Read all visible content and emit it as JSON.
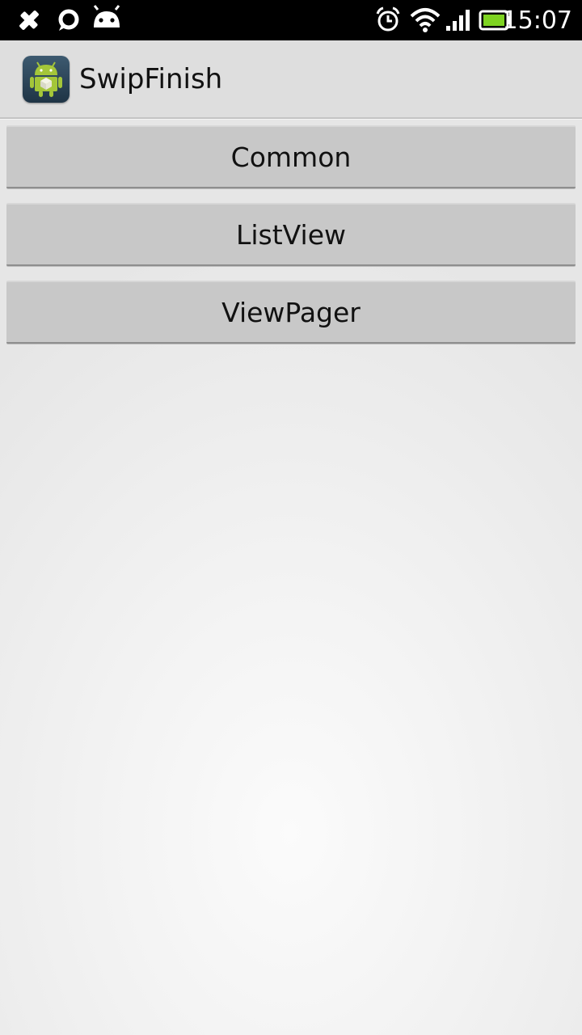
{
  "status_bar": {
    "time": "15:07",
    "left_icons": [
      "notification-icon",
      "chat-bubble-icon",
      "android-icon"
    ],
    "right_icons": [
      "alarm-icon",
      "wifi-icon",
      "signal-icon",
      "battery-icon"
    ],
    "battery_color": "#7ed321"
  },
  "action_bar": {
    "title": "SwipFinish",
    "icon": "android-app-icon"
  },
  "buttons": [
    {
      "label": "Common"
    },
    {
      "label": "ListView"
    },
    {
      "label": "ViewPager"
    }
  ]
}
